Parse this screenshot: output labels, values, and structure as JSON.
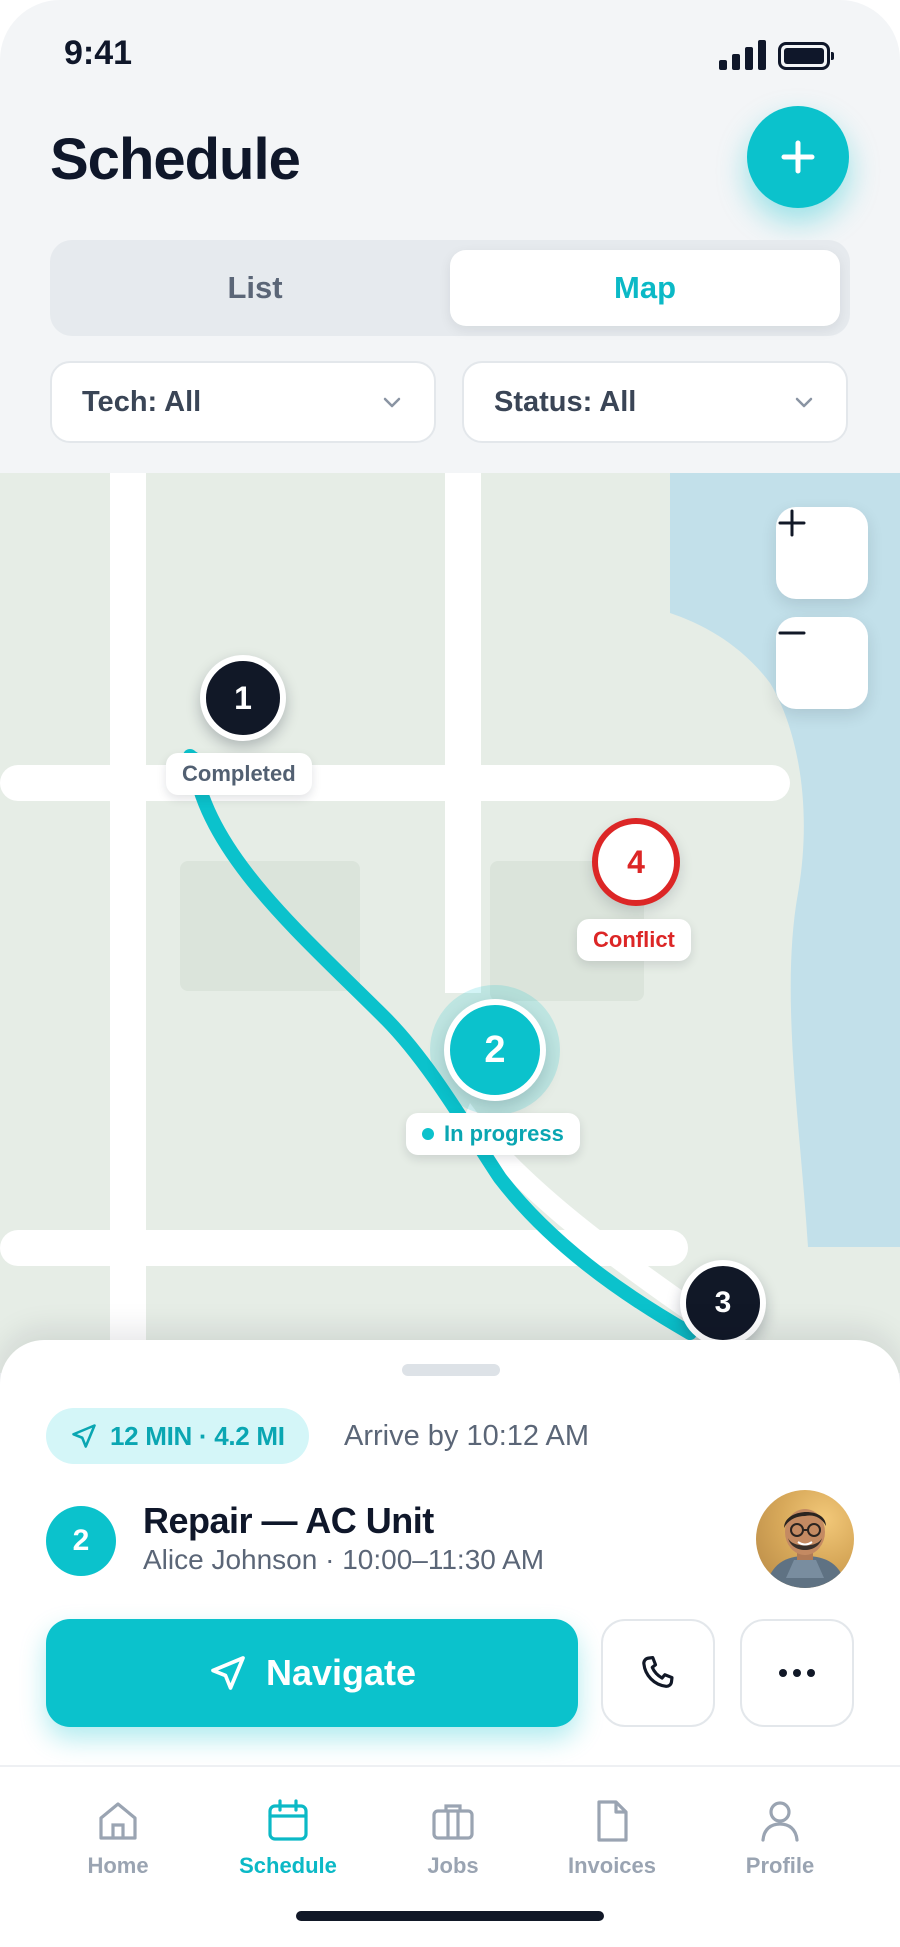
{
  "status_bar": {
    "time": "9:41"
  },
  "header": {
    "title": "Schedule",
    "add_icon": "plus-icon"
  },
  "view_toggle": {
    "options": [
      "List",
      "Map"
    ],
    "selected": "Map"
  },
  "filters": {
    "tech": {
      "label": "Tech: All"
    },
    "status": {
      "label": "Status: All"
    }
  },
  "map": {
    "stops": [
      {
        "number": "1",
        "status": "Completed"
      },
      {
        "number": "2",
        "status": "In progress"
      },
      {
        "number": "3",
        "status": ""
      },
      {
        "number": "4",
        "status": "Conflict"
      }
    ],
    "zoom_in_icon": "plus-icon",
    "zoom_out_icon": "minus-icon"
  },
  "sheet": {
    "eta": "12 MIN · 4.2 MI",
    "arrive_by": "Arrive by 10:12 AM",
    "job": {
      "number": "2",
      "title": "Repair — AC Unit",
      "subtitle": "Alice Johnson · 10:00–11:30 AM"
    },
    "navigate_label": "Navigate",
    "call_icon": "phone-icon",
    "more_icon": "more-icon"
  },
  "tabbar": {
    "items": [
      {
        "label": "Home",
        "icon": "home-icon"
      },
      {
        "label": "Schedule",
        "icon": "calendar-icon",
        "active": true
      },
      {
        "label": "Jobs",
        "icon": "briefcase-icon"
      },
      {
        "label": "Invoices",
        "icon": "document-icon"
      },
      {
        "label": "Profile",
        "icon": "user-icon"
      }
    ]
  },
  "colors": {
    "accent": "#0bc2cc",
    "conflict": "#dc2626",
    "dark": "#111827",
    "water": "#c2e0ea",
    "land": "#e6ede6"
  }
}
